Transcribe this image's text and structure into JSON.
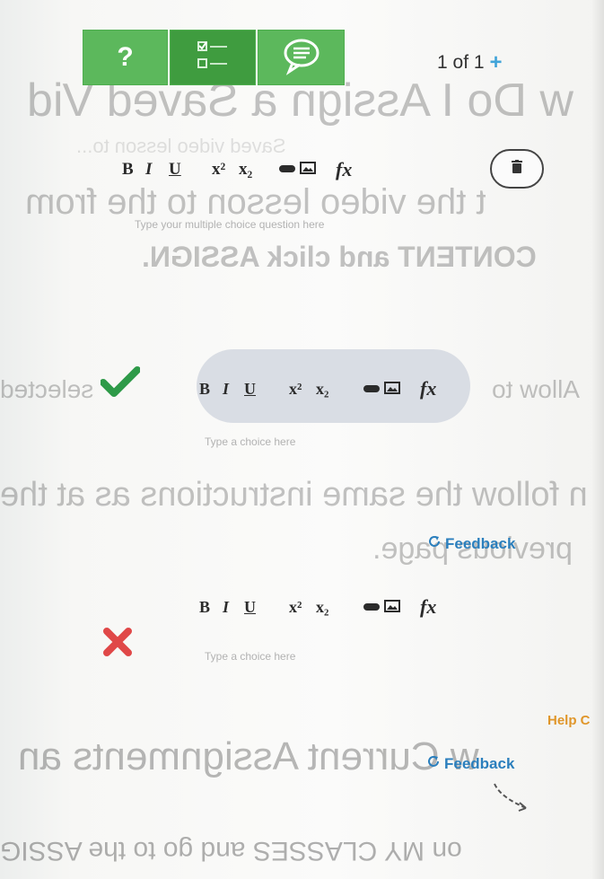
{
  "toolbar": {
    "mode_buttons": [
      {
        "label": "?",
        "icon": "help-icon"
      },
      {
        "label": "",
        "icon": "checklist-icon"
      },
      {
        "label": "",
        "icon": "speech-bubble-icon"
      }
    ],
    "counter": "1 of 1",
    "add_label": "+"
  },
  "format_toolbar": {
    "bold": "B",
    "italic": "I",
    "underline": "U",
    "superscript": "x²",
    "subscript": "x₂",
    "link_icon": "link-icon",
    "image_icon": "image-icon",
    "formula": "fx"
  },
  "question": {
    "placeholder": "Type your multiple choice question here",
    "delete_icon": "trash-icon"
  },
  "choices": [
    {
      "status": "correct",
      "status_icon": "checkmark-icon",
      "placeholder": "Type a choice here",
      "feedback": "Feedback"
    },
    {
      "status": "incorrect",
      "status_icon": "x-mark-icon",
      "placeholder": "Type a choice here",
      "feedback": "Feedback"
    }
  ],
  "help_label": "Help C",
  "colors": {
    "green": "#5cb85c",
    "green_dark": "#3f9c3f",
    "blue": "#2b7fbd",
    "check_green": "#2e9a48",
    "x_red": "#e04848",
    "help_orange": "#e0962a"
  },
  "show_through": {
    "line1": "w Do I Assign a Saved Vid",
    "line2": "Saved video lesson to...",
    "line3": "t the video lesson to the from",
    "line4": "CONTENT and click ASSIGN.",
    "line5": "selected",
    "line6": "Allow to",
    "line7": "n follow the same instructions as at the",
    "line8": "previous page.",
    "line9": "w Current Assignments an",
    "line10": "on MY CLASSES and go to the ASSIG"
  }
}
